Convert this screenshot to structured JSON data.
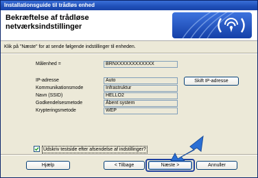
{
  "window": {
    "title": "Installationsguide til trådløs enhed"
  },
  "header": {
    "title_line1": "Bekræftelse af trådløse",
    "title_line2": "netværksindstillinger"
  },
  "instruction": "Klik på \"Næste\" for at sende følgende indstillinger til enheden.",
  "target": {
    "label": "Målenhed =",
    "value": "BRNXXXXXXXXXXXX"
  },
  "settings": [
    {
      "label": "IP-adresse",
      "value": "Auto"
    },
    {
      "label": "Kommunikationsmode",
      "value": "Infrastruktur"
    },
    {
      "label": "Navn (SSID)",
      "value": "HELLO2"
    },
    {
      "label": "Godkendelsesmetode",
      "value": "Åbent system"
    },
    {
      "label": "Krypteringsmetode",
      "value": "WEP"
    }
  ],
  "buttons": {
    "change_ip": "Skift IP-adresse",
    "help": "Hjælp",
    "back": "< Tilbage",
    "next": "Næste >",
    "cancel": "Annuller"
  },
  "checkbox": {
    "label": "Udskriv testside efter afsendelse af indstillinger?",
    "checked": true
  },
  "colors": {
    "titlebar": "#1f4fb8",
    "logo": "#1f54c4",
    "arrow": "#2a6fd4",
    "dialog_bg": "#ece9d8"
  },
  "icons": {
    "logo": "wireless-signal-icon",
    "arrow": "pointer-arrow-icon",
    "check": "check-icon"
  }
}
